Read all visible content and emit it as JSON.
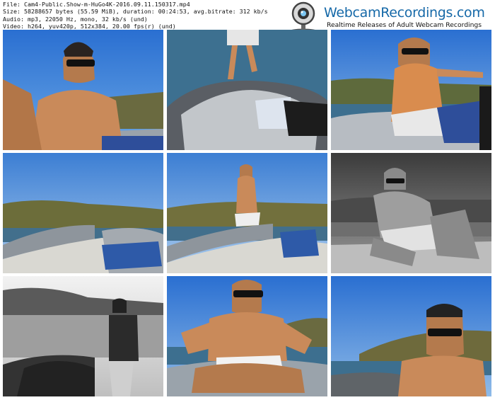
{
  "file_info": {
    "file": "File: Cam4-Public.Show-m-HuGo4K-2016.09.11.150317.mp4",
    "size": "Size: 58288657 bytes (55.59 MiB), duration: 00:24:53, avg.bitrate: 312 kb/s",
    "audio": "Audio: mp3, 22050 Hz, mono, 32 kb/s (und)",
    "video": "Video: h264, yuv420p, 512x384, 20.00 fps(r) (und)"
  },
  "watermark": {
    "name": "WebcamRecordings.com",
    "tagline": "Realtime Releases of Adult Webcam Recordings",
    "icon": "webcam-icon"
  },
  "thumbnails": [
    {
      "id": 1,
      "scene": "color",
      "desc": "selfie"
    },
    {
      "id": 2,
      "scene": "color",
      "desc": "boat-bow"
    },
    {
      "id": 3,
      "scene": "color",
      "desc": "sitting"
    },
    {
      "id": 4,
      "scene": "color",
      "desc": "empty-boat"
    },
    {
      "id": 5,
      "scene": "color",
      "desc": "standing-distant"
    },
    {
      "id": 6,
      "scene": "grayscale",
      "desc": "reclining"
    },
    {
      "id": 7,
      "scene": "grayscale",
      "desc": "silhouette"
    },
    {
      "id": 8,
      "scene": "color",
      "desc": "cross-legged"
    },
    {
      "id": 9,
      "scene": "color",
      "desc": "close-selfie"
    }
  ],
  "colors": {
    "sky": "#3f86d6",
    "sea": "#3d6f8f",
    "hill": "#6e6a3c",
    "boat": "#9aa0a6",
    "skin": "#c98a5a",
    "brand_blue": "#1669a8"
  }
}
